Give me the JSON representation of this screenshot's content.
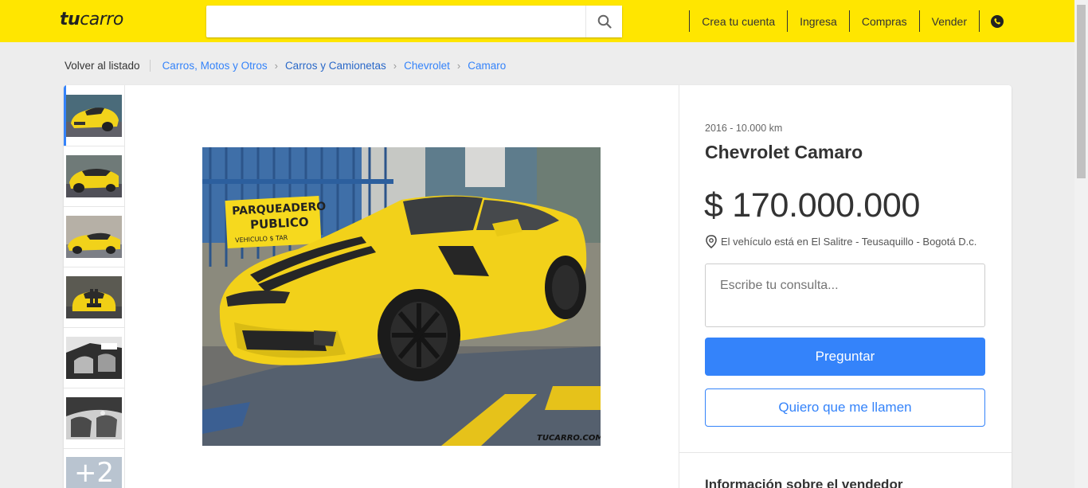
{
  "header": {
    "logo_bold": "tu",
    "logo_rest": "carro",
    "search_placeholder": "",
    "nav": [
      "Crea tu cuenta",
      "Ingresa",
      "Compras",
      "Vender"
    ],
    "colors": {
      "bar": "#ffe600",
      "accent": "#3483fa"
    }
  },
  "breadcrumb": {
    "back": "Volver al listado",
    "items": [
      "Carros, Motos y Otros",
      "Carros y Camionetas",
      "Chevrolet",
      "Camaro"
    ]
  },
  "gallery": {
    "more_label": "+2",
    "thumb_icons": [
      "car-front-thumb",
      "car-rear-thumb",
      "car-side-thumb",
      "car-front-view-thumb",
      "interior-thumb",
      "interior-rear-thumb"
    ]
  },
  "listing": {
    "subtitle": "2016  -  10.000 km",
    "title": "Chevrolet Camaro",
    "price": "$ 170.000.000",
    "location": "El vehículo está en El Salitre - Teusaquillo - Bogotá D.c.",
    "question_placeholder": "Escribe tu consulta...",
    "ask_button": "Preguntar",
    "call_button": "Quiero que me llamen",
    "seller_heading": "Información sobre el vendedor"
  },
  "photo": {
    "sign_line1": "PARQUEADERO",
    "sign_line2": "PUBLICO",
    "sign_line3": "VEHICULO $ TAR",
    "watermark": "TUCARRO.COM"
  }
}
